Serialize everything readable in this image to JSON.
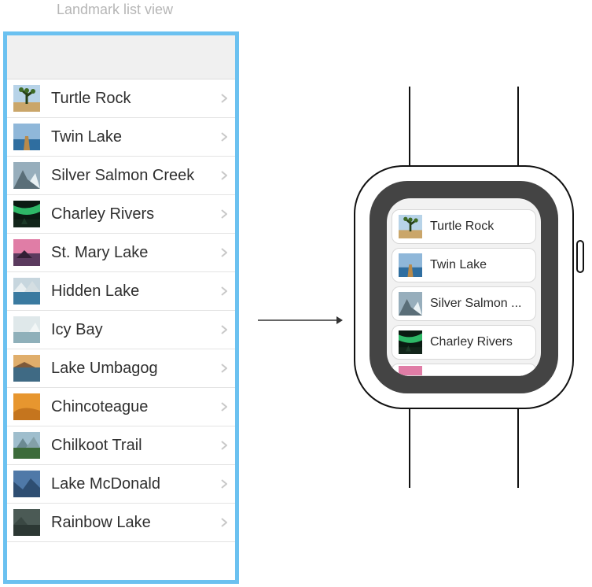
{
  "caption": "Landmark list view",
  "phone": {
    "items": [
      {
        "label": "Turtle Rock",
        "icon": "joshua-tree"
      },
      {
        "label": "Twin Lake",
        "icon": "dock-lake"
      },
      {
        "label": "Silver Salmon Creek",
        "icon": "snow-peaks"
      },
      {
        "label": "Charley Rivers",
        "icon": "aurora"
      },
      {
        "label": "St. Mary Lake",
        "icon": "pink-sunset"
      },
      {
        "label": "Hidden Lake",
        "icon": "glacier-lake"
      },
      {
        "label": "Icy Bay",
        "icon": "ice-water"
      },
      {
        "label": "Lake Umbagog",
        "icon": "calm-lake"
      },
      {
        "label": "Chincoteague",
        "icon": "orange-dunes"
      },
      {
        "label": "Chilkoot Trail",
        "icon": "forest-ridge"
      },
      {
        "label": "Lake McDonald",
        "icon": "blue-valley"
      },
      {
        "label": "Rainbow Lake",
        "icon": "dark-cove"
      }
    ]
  },
  "watch": {
    "items": [
      {
        "label": "Turtle Rock",
        "icon": "joshua-tree"
      },
      {
        "label": "Twin Lake",
        "icon": "dock-lake"
      },
      {
        "label": "Silver Salmon ...",
        "icon": "snow-peaks"
      },
      {
        "label": "Charley Rivers",
        "icon": "aurora"
      },
      {
        "label": "",
        "icon": "pink-sunset"
      }
    ]
  }
}
